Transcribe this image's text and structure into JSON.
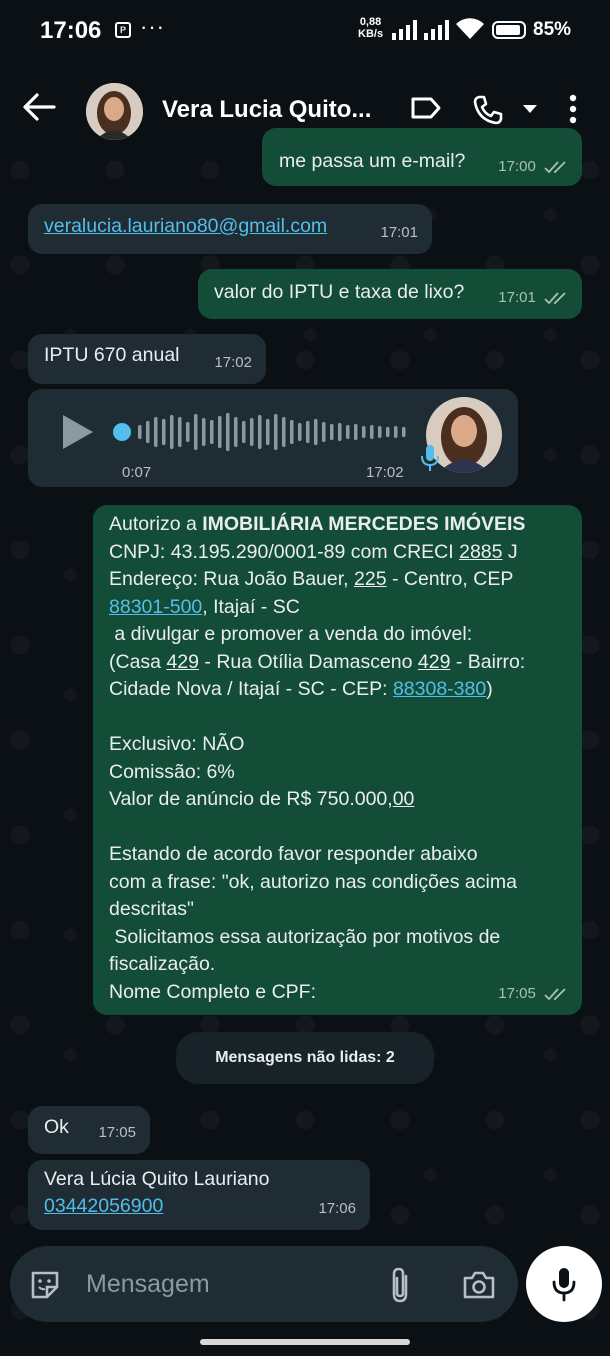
{
  "status_bar": {
    "time": "17:06",
    "app_icon": "P",
    "dots": "···",
    "net_speed_value": "0,88",
    "net_speed_unit": "KB/s",
    "battery": "85%"
  },
  "header": {
    "contact_name": "Vera Lucia Quito...",
    "icons": [
      "arrow-left",
      "label-tag",
      "phone",
      "dropdown",
      "more-vertical"
    ]
  },
  "messages": {
    "m1": {
      "text": "me passa um e-mail?",
      "time": "17:00"
    },
    "m2": {
      "text": "veralucia.lauriano80@gmail.com",
      "time": "17:01"
    },
    "m3": {
      "text": "valor do IPTU e taxa de lixo?",
      "time": "17:01"
    },
    "m4": {
      "text": "IPTU 670 anual",
      "time": "17:02"
    },
    "voice": {
      "duration": "0:07",
      "time": "17:02"
    },
    "auth": {
      "time": "17:05",
      "l1": "Autorizo a ",
      "l1b": "IMOBILIÁRIA MERCEDES IMÓVEIS",
      "l2a": "CNPJ: 43.195.290/0001-89 com CRECI ",
      "l2b": "2885",
      "l2c": " J",
      "l3a": "Endereço: Rua João Bauer, ",
      "l3b": "225",
      "l3c": " - Centro, CEP",
      "l4a": "88301-500",
      "l4b": ", Itajaí - SC",
      "l5": " a divulgar e promover a venda do imóvel:",
      "l6a": "(Casa ",
      "l6b": "429",
      "l6c": " - Rua Otília Damasceno ",
      "l6d": "429",
      "l6e": " - Bairro:",
      "l7a": "Cidade Nova / Itajaí - SC - CEP: ",
      "l7b": "88308-380",
      "l7c": ")",
      "l8": "Exclusivo: NÃO",
      "l9": "Comissão: 6%",
      "l10a": "Valor de anúncio de R$ 750.000,",
      "l10b": "00",
      "l11": "Estando de acordo favor responder abaixo",
      "l12": "com a frase: \"ok, autorizo nas condições acima",
      "l13": "descritas\"",
      "l14": " Solicitamos essa autorização por motivos de",
      "l15": "fiscalização.",
      "l16": "Nome Completo e CPF:"
    },
    "unread_label": "Mensagens não lidas: 2",
    "m5": {
      "text": "Ok",
      "time": "17:05"
    },
    "m6": {
      "line1": "Vera Lúcia Quito Lauriano",
      "line2": "03442056900",
      "time": "17:06"
    }
  },
  "input": {
    "placeholder": "Mensagem",
    "icons": [
      "sticker",
      "attach",
      "camera",
      "mic"
    ]
  },
  "colors": {
    "outgoing": "#144d37",
    "incoming": "#1f2c33",
    "link": "#53bdeb",
    "background": "#0b1014"
  }
}
